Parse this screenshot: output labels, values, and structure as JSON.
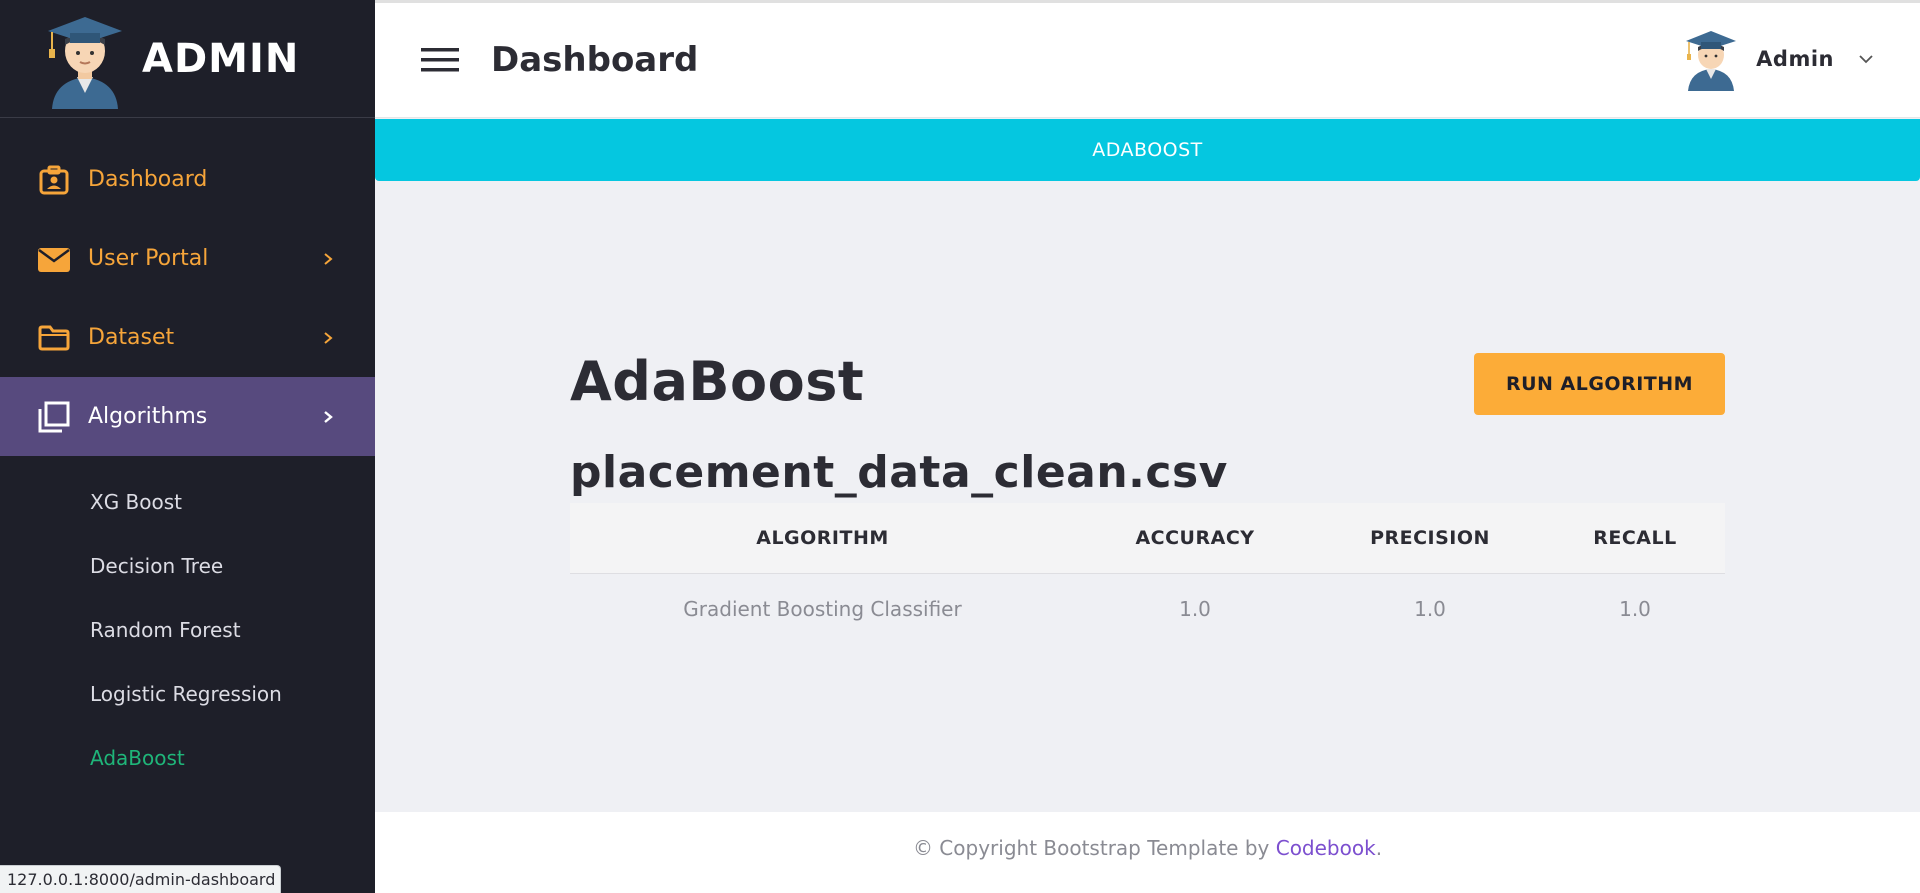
{
  "sidebar": {
    "brand": "ADMIN",
    "nav": [
      {
        "label": "Dashboard",
        "icon": "id-badge-icon",
        "has_chevron": false
      },
      {
        "label": "User Portal",
        "icon": "envelope-icon",
        "has_chevron": true
      },
      {
        "label": "Dataset",
        "icon": "folder-icon",
        "has_chevron": true
      },
      {
        "label": "Algorithms",
        "icon": "layers-icon",
        "has_chevron": true,
        "active": true
      }
    ],
    "submenu": [
      "XG Boost",
      "Decision Tree",
      "Random Forest",
      "Logistic Regression",
      "AdaBoost"
    ],
    "current_submenu": "AdaBoost"
  },
  "topbar": {
    "title": "Dashboard",
    "user_name": "Admin"
  },
  "banner": {
    "text": "ADABOOST"
  },
  "main": {
    "title": "AdaBoost",
    "run_button": "RUN ALGORITHM",
    "dataset": "placement_data_clean.csv",
    "table": {
      "headers": [
        "ALGORITHM",
        "ACCURACY",
        "PRECISION",
        "RECALL"
      ],
      "rows": [
        [
          "Gradient Boosting Classifier",
          "1.0",
          "1.0",
          "1.0"
        ]
      ]
    }
  },
  "footer": {
    "text": "© Copyright Bootstrap Template by ",
    "link": "Codebook",
    "suffix": "."
  },
  "status_bar": {
    "url": "127.0.0.1:8000/admin-dashboard"
  },
  "colors": {
    "sidebar_bg": "#1e1f29",
    "accent_orange": "#f6a53a",
    "active_bg": "#574a7e",
    "banner_cyan": "#05c7e0",
    "button_orange": "#fcac38",
    "current_green": "#1fb579",
    "link_purple": "#7c4fcf"
  }
}
